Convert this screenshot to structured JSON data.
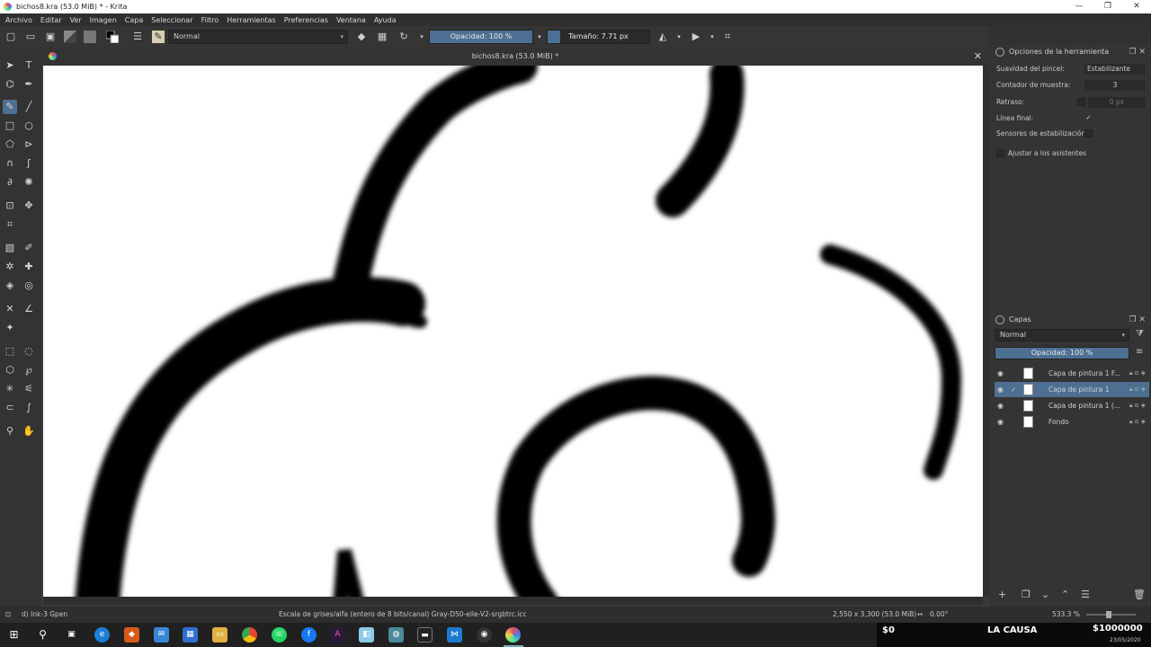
{
  "window": {
    "title": "bichos8.kra (53.0 MiB) * - Krita",
    "controls": {
      "minimize": "—",
      "maximize": "❐",
      "close": "✕"
    }
  },
  "menu": [
    "Archivo",
    "Editar",
    "Ver",
    "Imagen",
    "Capa",
    "Seleccionar",
    "Filtro",
    "Herramientas",
    "Preferencias",
    "Ventana",
    "Ayuda"
  ],
  "toolbar": {
    "blend_mode": "Normal",
    "opacity": "Opacidad: 100 %",
    "opacity_level": 1.0,
    "size": "Tamaño: 7.71 px",
    "size_level": 0.12
  },
  "document": {
    "tab_title": "bichos8.kra (53.0 MiB) *",
    "close": "✕"
  },
  "tool_options": {
    "title": "Opciones de la herramienta",
    "smoothing_label": "Suavidad del pincel:",
    "smoothing_value": "Estabilizante",
    "sample_count_label": "Contador de muestra:",
    "sample_count_value": "3",
    "delay_label": "Retraso:",
    "delay_value": "0 px",
    "finish_line_label": "Línea final:",
    "finish_line_check": "✓",
    "stabilize_sensors_label": "Sensores de estabilización:",
    "snap_assistants_label": "Ajustar a los asistentes"
  },
  "layers": {
    "title": "Capas",
    "blend_mode": "Normal",
    "opacity": "Opacidad: 100 %",
    "opacity_level": 1.0,
    "items": [
      {
        "name": "Capa de pintura 1 F...",
        "selected": false,
        "check": ""
      },
      {
        "name": "Capa de pintura 1",
        "selected": true,
        "check": "✓"
      },
      {
        "name": "Capa de pintura 1 (...",
        "selected": false,
        "check": ""
      },
      {
        "name": "Fondo",
        "selected": false,
        "check": ""
      }
    ]
  },
  "status": {
    "brush": "d) Ink-3 Gpen",
    "color_profile": "Escala de grises/alfa (entero de 8 bits/canal)  Gray-D50-elle-V2-srgbtrc.icc",
    "image_size": "2,550 x 3,300 (53.0 MiB)",
    "rotation": "0.00°",
    "zoom": "533.3 %"
  },
  "overlay": {
    "left": "$0",
    "center": "LA CAUSA",
    "right": "$1000000",
    "date": "23/05/2020"
  },
  "taskbar_icons": [
    "windows-start",
    "search",
    "task-view",
    "edge",
    "colorful-app",
    "mail",
    "store",
    "file-explorer",
    "chrome",
    "whatsapp",
    "facebook",
    "affinity",
    "note-app",
    "network-app",
    "terminal",
    "vscode",
    "obs",
    "krita"
  ]
}
